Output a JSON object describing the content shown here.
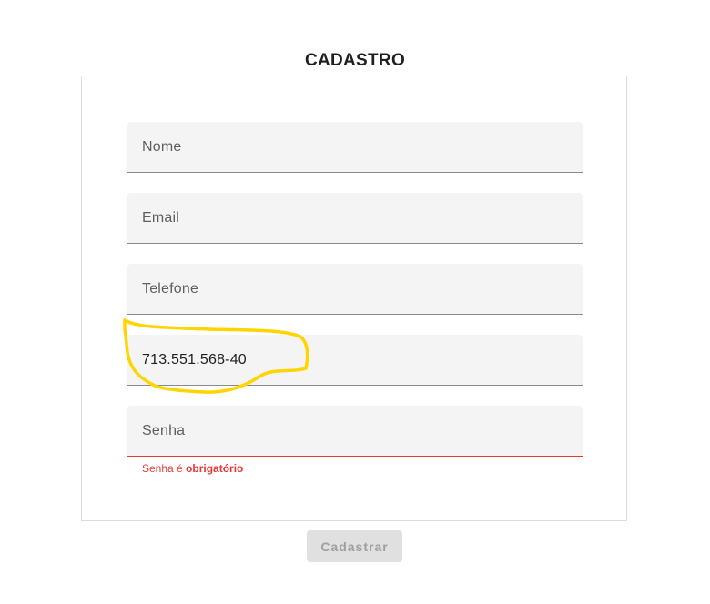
{
  "form": {
    "title": "CADASTRO",
    "fields": {
      "nome": {
        "placeholder": "Nome",
        "value": ""
      },
      "email": {
        "placeholder": "Email",
        "value": ""
      },
      "telefone": {
        "placeholder": "Telefone",
        "value": ""
      },
      "cpf": {
        "placeholder": "",
        "value": "713.551.568-40"
      },
      "senha": {
        "placeholder": "Senha",
        "value": "",
        "error_prefix": "Senha é ",
        "error_emphasis": "obrigatório"
      }
    },
    "submit_label": "Cadastrar"
  },
  "colors": {
    "error": "#e53935",
    "annotation": "#ffd400",
    "field_background": "#f4f4f4",
    "disabled_button": "#e0e0e0"
  }
}
